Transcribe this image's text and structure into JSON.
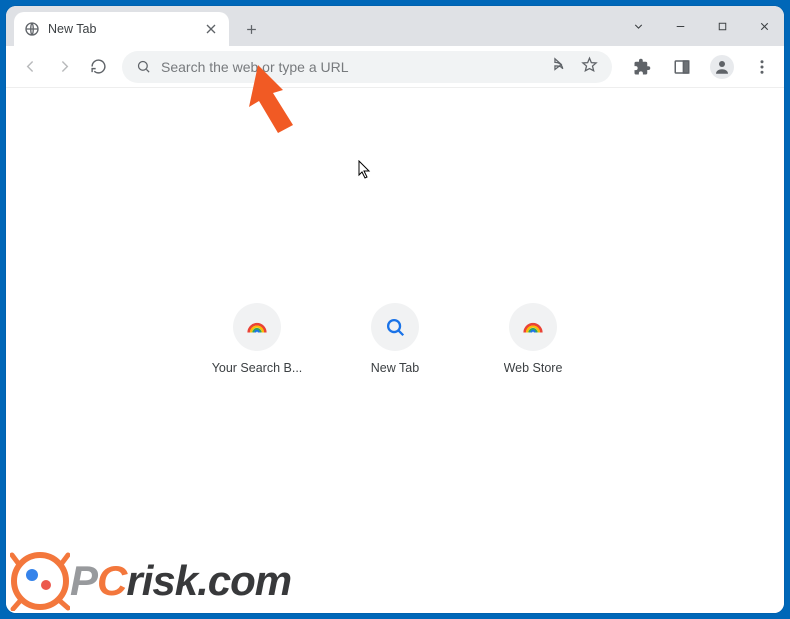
{
  "tab": {
    "title": "New Tab"
  },
  "omnibox": {
    "placeholder": "Search the web or type a URL",
    "value": ""
  },
  "shortcuts": [
    {
      "label": "Your Search B...",
      "icon": "rainbow"
    },
    {
      "label": "New Tab",
      "icon": "search"
    },
    {
      "label": "Web Store",
      "icon": "rainbow"
    }
  ],
  "watermark": {
    "p": "P",
    "c": "C",
    "rest": "risk.com"
  },
  "colors": {
    "accent": "#0067b8",
    "arrow": "#f15a24",
    "pcOrange": "#f26522",
    "pcGrey": "#8a8d90"
  }
}
